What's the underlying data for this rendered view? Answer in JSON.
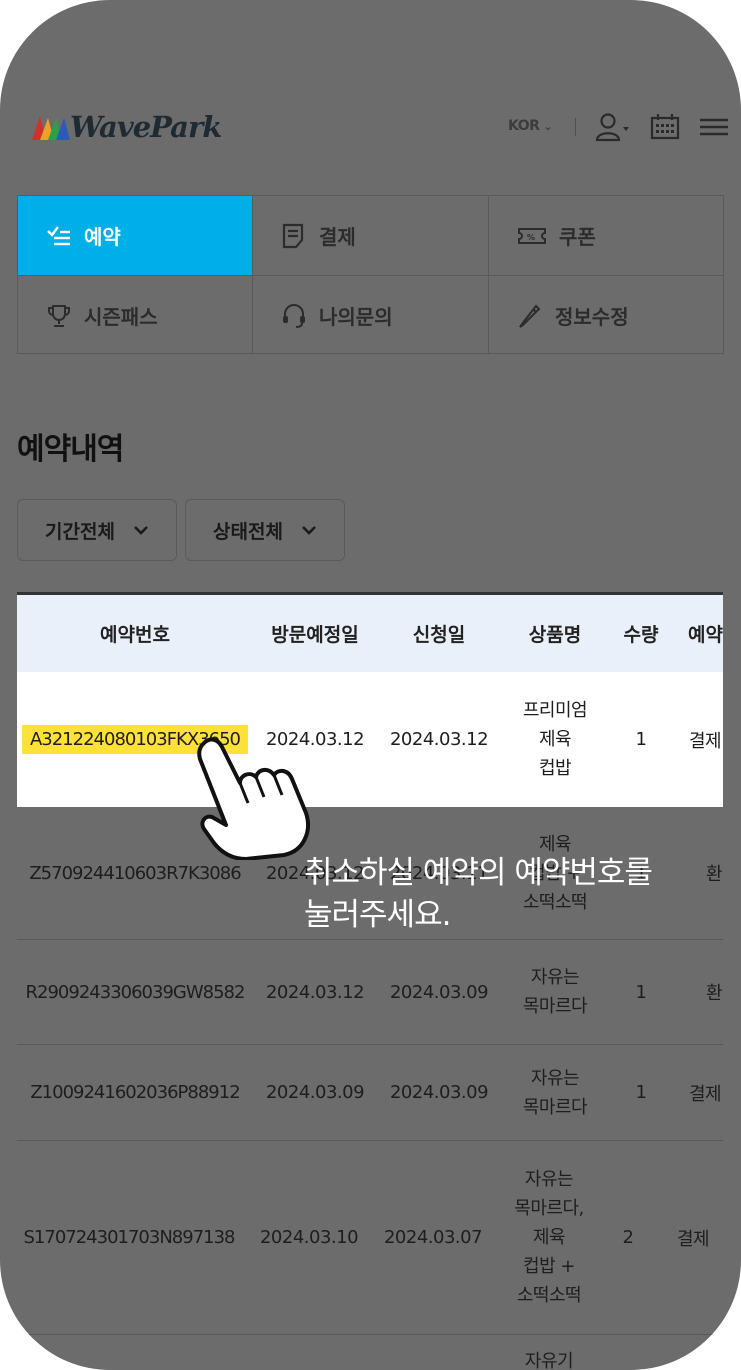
{
  "header": {
    "logo_text": "WavePark",
    "language": "KOR",
    "icons": [
      "user-icon",
      "calendar-icon",
      "hamburger-menu-icon"
    ]
  },
  "menu": {
    "items": [
      {
        "label": "예약",
        "icon": "checklist-icon",
        "active": true
      },
      {
        "label": "결제",
        "icon": "receipt-icon",
        "active": false
      },
      {
        "label": "쿠폰",
        "icon": "coupon-icon",
        "active": false
      },
      {
        "label": "시즌패스",
        "icon": "trophy-icon",
        "active": false
      },
      {
        "label": "나의문의",
        "icon": "headset-icon",
        "active": false
      },
      {
        "label": "정보수정",
        "icon": "pencil-icon",
        "active": false
      }
    ]
  },
  "section_title": "예약내역",
  "filters": {
    "period": "기간전체",
    "status": "상태전체"
  },
  "table": {
    "headers": [
      "예약번호",
      "방문예정일",
      "신청일",
      "상품명",
      "수량",
      "예약"
    ],
    "rows": [
      {
        "code": "A321224080103FKX3650",
        "visit": "2024.03.12",
        "applied": "2024.03.12",
        "product": [
          "프리미엄",
          "제육",
          "컵밥"
        ],
        "qty": "1",
        "status": "결제"
      },
      {
        "code": "Z570924410603R7K3086",
        "visit": "2024.03.12",
        "applied": "2024.03.11",
        "product": [
          "제육",
          "컵밥 +",
          "소떡소떡"
        ],
        "qty": "1",
        "status": "환"
      },
      {
        "code": "R2909243306039GW8582",
        "visit": "2024.03.12",
        "applied": "2024.03.09",
        "product": [
          "자유는",
          "목마르다"
        ],
        "qty": "1",
        "status": "환"
      },
      {
        "code": "Z1009241602036P88912",
        "visit": "2024.03.09",
        "applied": "2024.03.09",
        "product": [
          "자유는",
          "목마르다"
        ],
        "qty": "1",
        "status": "결제"
      },
      {
        "code": "S170724301703N897138",
        "visit": "2024.03.10",
        "applied": "2024.03.07",
        "product": [
          "자유는",
          "목마르다,",
          "제육",
          "컵밥 +",
          "소떡소떡"
        ],
        "qty": "2",
        "status": "결제"
      },
      {
        "code": "",
        "visit": "",
        "applied": "",
        "product": [
          "자유기"
        ],
        "qty": "",
        "status": ""
      }
    ]
  },
  "hint": {
    "line1": "취소하실 예약의 예약번호를",
    "line2": "눌러주세요."
  },
  "colors": {
    "active_tab": "#00aee8",
    "highlight": "#ffe13a",
    "overlay": "#6c6c6c",
    "header_row": "#eaf0fa"
  }
}
